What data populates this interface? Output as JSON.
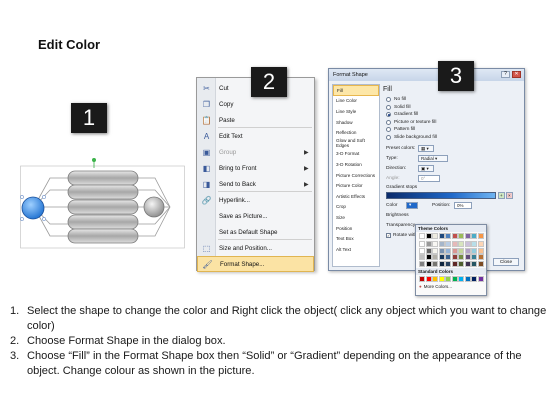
{
  "title": "Edit Color",
  "steps": [
    "1",
    "2",
    "3"
  ],
  "context_menu": {
    "items": [
      {
        "label": "Cut",
        "icon": "scissors-icon",
        "glyph": "✂",
        "disabled": false,
        "submenu": false
      },
      {
        "label": "Copy",
        "icon": "copy-icon",
        "glyph": "❐",
        "disabled": false,
        "submenu": false
      },
      {
        "label": "Paste",
        "icon": "paste-icon",
        "glyph": "📋",
        "disabled": false,
        "submenu": false
      },
      {
        "label": "Edit Text",
        "icon": "edit-text-icon",
        "glyph": "A",
        "disabled": false,
        "submenu": false
      },
      {
        "label": "Group",
        "icon": "group-icon",
        "glyph": "▣",
        "disabled": true,
        "submenu": true
      },
      {
        "label": "Bring to Front",
        "icon": "bring-to-front-icon",
        "glyph": "◧",
        "disabled": false,
        "submenu": true
      },
      {
        "label": "Send to Back",
        "icon": "send-to-back-icon",
        "glyph": "◨",
        "disabled": false,
        "submenu": true
      },
      {
        "label": "Hyperlink...",
        "icon": "hyperlink-icon",
        "glyph": "🔗",
        "disabled": false,
        "submenu": false
      },
      {
        "label": "Save as Picture...",
        "icon": "",
        "glyph": "",
        "disabled": false,
        "submenu": false
      },
      {
        "label": "Set as Default Shape",
        "icon": "",
        "glyph": "",
        "disabled": false,
        "submenu": false
      },
      {
        "label": "Size and Position...",
        "icon": "size-position-icon",
        "glyph": "⬚",
        "disabled": false,
        "submenu": false
      },
      {
        "label": "Format Shape...",
        "icon": "format-shape-icon",
        "glyph": "🖌",
        "disabled": false,
        "submenu": false,
        "selected": true
      }
    ]
  },
  "format_dialog": {
    "title": "Format Shape",
    "nav": [
      "Fill",
      "Line Color",
      "Line Style",
      "Shadow",
      "Reflection",
      "Glow and Soft Edges",
      "3-D Format",
      "3-D Rotation",
      "Picture Corrections",
      "Picture Color",
      "Artistic Effects",
      "Crop",
      "Size",
      "Position",
      "Text Box",
      "Alt Text"
    ],
    "pane_heading": "Fill",
    "fill_options": [
      {
        "label": "No fill",
        "on": false
      },
      {
        "label": "Solid fill",
        "on": false
      },
      {
        "label": "Gradient fill",
        "on": true
      },
      {
        "label": "Picture or texture fill",
        "on": false
      },
      {
        "label": "Pattern fill",
        "on": false
      },
      {
        "label": "Slide background fill",
        "on": false
      }
    ],
    "preset_label": "Preset colors:",
    "type_label": "Type:",
    "type_value": "Radial",
    "direction_label": "Direction:",
    "angle_label": "Angle:",
    "angle_value": "0°",
    "stops_label": "Gradient stops",
    "color_label": "Color",
    "position_label": "Position:",
    "position_value": "0%",
    "brightness_label": "Brightness",
    "transparency_label": "Transparency",
    "rotate_label": "Rotate with shape",
    "close_label": "Close"
  },
  "color_popup": {
    "theme_label": "Theme Colors",
    "standard_label": "Standard Colors",
    "more_label": "More Colors...",
    "theme_colors": [
      "#ffffff",
      "#000000",
      "#eeece1",
      "#1f497d",
      "#4f81bd",
      "#c0504d",
      "#9bbb59",
      "#8064a2",
      "#4bacc6",
      "#f79646"
    ],
    "standard_colors": [
      "#c00000",
      "#ff0000",
      "#ffc000",
      "#ffff00",
      "#92d050",
      "#00b050",
      "#00b0f0",
      "#0070c0",
      "#002060",
      "#7030a0"
    ]
  },
  "instructions": [
    {
      "num": "1.",
      "text": "Select the shape to change the color and Right click the object( click any object which you want to change color)"
    },
    {
      "num": "2.",
      "text": "Choose Format Shape in the dialog box."
    },
    {
      "num": "3.",
      "text": "Choose “Fill” in the Format Shape box then “Solid” or “Gradient” depending on the appearance of the object. Change colour as shown in the picture."
    }
  ]
}
